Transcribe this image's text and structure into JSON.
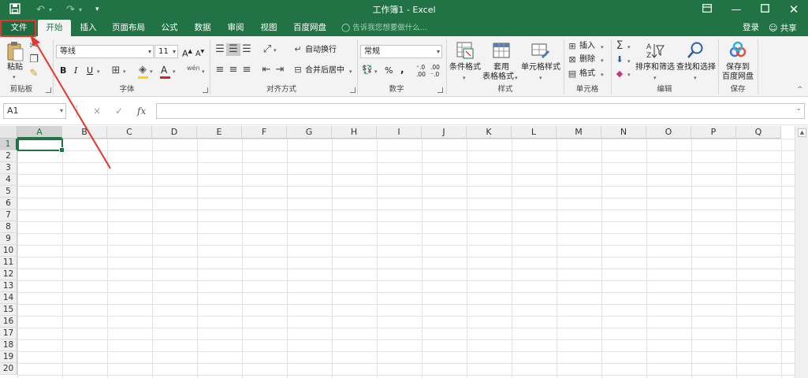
{
  "titlebar": {
    "title": "工作簿1 - Excel",
    "save_icon": "save-icon",
    "undo_icon": "undo-icon",
    "redo_icon": "redo-icon",
    "customize_icon": "customize-quick-access-icon",
    "ribbon_display_icon": "ribbon-display-options-icon",
    "minimize_icon": "minimize-icon",
    "maximize_icon": "maximize-icon",
    "close_icon": "close-icon"
  },
  "tabs": [
    {
      "label": "文件"
    },
    {
      "label": "开始"
    },
    {
      "label": "插入"
    },
    {
      "label": "页面布局"
    },
    {
      "label": "公式"
    },
    {
      "label": "数据"
    },
    {
      "label": "审阅"
    },
    {
      "label": "视图"
    },
    {
      "label": "百度网盘"
    }
  ],
  "active_tab": "开始",
  "tell_me": "告诉我您想要做什么...",
  "account": {
    "login": "登录",
    "share": "共享"
  },
  "ribbon": {
    "clipboard": {
      "label": "剪贴板",
      "paste": "粘贴"
    },
    "font": {
      "label": "字体",
      "font_name": "等线",
      "font_size": "11",
      "bold": "B",
      "italic": "I",
      "underline": "U",
      "grow": "A",
      "shrink": "A",
      "font_color": "A",
      "phonetic": "wén"
    },
    "alignment": {
      "label": "对齐方式",
      "wrap_text": "自动换行",
      "merge_center": "合并后居中"
    },
    "number": {
      "label": "数字",
      "format": "常规",
      "percent": "%",
      "comma": ","
    },
    "styles": {
      "label": "样式",
      "conditional": "条件格式",
      "format_table_1": "套用",
      "format_table_2": "表格格式",
      "cell_styles": "单元格样式"
    },
    "cells": {
      "label": "单元格",
      "insert": "插入",
      "delete": "删除",
      "format": "格式"
    },
    "editing": {
      "label": "编辑",
      "sort_filter": "排序和筛选",
      "find_select": "查找和选择"
    },
    "save": {
      "label": "保存",
      "save_to_1": "保存到",
      "save_to_2": "百度网盘"
    }
  },
  "formula_bar": {
    "name_box": "A1",
    "cancel": "×",
    "enter": "✓",
    "fx": "fx",
    "formula": ""
  },
  "columns": [
    "A",
    "B",
    "C",
    "D",
    "E",
    "F",
    "G",
    "H",
    "I",
    "J",
    "K",
    "L",
    "M",
    "N",
    "O",
    "P",
    "Q"
  ],
  "rows": [
    "1",
    "2",
    "3",
    "4",
    "5",
    "6",
    "7",
    "8",
    "9",
    "10",
    "11",
    "12",
    "13",
    "14",
    "15",
    "16",
    "17",
    "18",
    "19",
    "20"
  ],
  "selected_cell": "A1",
  "colors": {
    "accent": "#217346",
    "annotation": "#e8352b"
  }
}
